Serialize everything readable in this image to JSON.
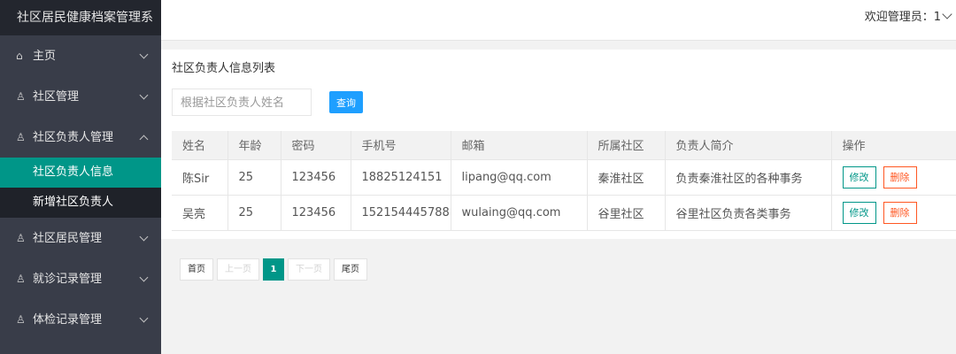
{
  "sidebar": {
    "title": "社区居民健康档案管理系",
    "items": [
      {
        "label": "主页",
        "icon": "home-icon",
        "glyph": "⌂",
        "expanded": false
      },
      {
        "label": "社区管理",
        "icon": "user-icon",
        "glyph": "♙",
        "expanded": false
      },
      {
        "label": "社区负责人管理",
        "icon": "user-icon",
        "glyph": "♙",
        "expanded": true
      },
      {
        "label": "社区居民管理",
        "icon": "user-icon",
        "glyph": "♙",
        "expanded": false
      },
      {
        "label": "就诊记录管理",
        "icon": "user-icon",
        "glyph": "♙",
        "expanded": false
      },
      {
        "label": "体检记录管理",
        "icon": "user-icon",
        "glyph": "♙",
        "expanded": false
      }
    ],
    "subitems": [
      {
        "label": "社区负责人信息",
        "active": true
      },
      {
        "label": "新增社区负责人",
        "active": false
      }
    ]
  },
  "header": {
    "welcome": "欢迎管理员：1"
  },
  "main": {
    "title": "社区负责人信息列表",
    "search": {
      "placeholder": "根据社区负责人姓名",
      "value": ""
    },
    "search_button": "查询",
    "table": {
      "columns": [
        "姓名",
        "年龄",
        "密码",
        "手机号",
        "邮箱",
        "所属社区",
        "负责人简介",
        "操作"
      ],
      "rows": [
        [
          "陈Sir",
          "25",
          "123456",
          "18825124151",
          "lipang@qq.com",
          "秦淮社区",
          "负责秦淮社区的各种事务"
        ],
        [
          "吴亮",
          "25",
          "123456",
          "152154445788",
          "wulaing@qq.com",
          "谷里社区",
          "谷里社区负责各类事务"
        ]
      ],
      "edit_label": "修改",
      "delete_label": "删除"
    }
  },
  "pagination": {
    "first": "首页",
    "prev": "上一页",
    "current": "1",
    "next": "下一页",
    "last": "尾页"
  },
  "colors": {
    "sidebar_bg": "#393d49",
    "active": "#009688",
    "primary_button": "#1e9fff",
    "danger": "#ff5722"
  }
}
